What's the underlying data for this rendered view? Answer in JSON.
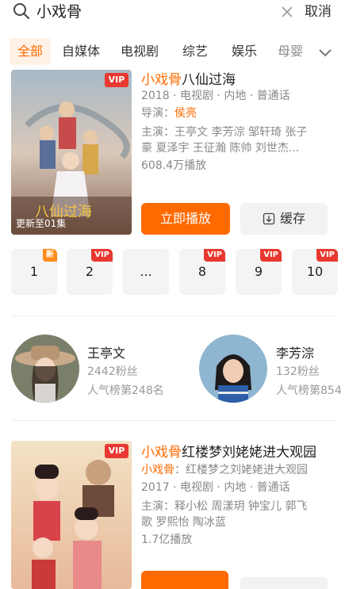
{
  "search": {
    "query": "小戏骨",
    "cancel_label": "取消"
  },
  "tabs": [
    {
      "label": "全部",
      "active": true
    },
    {
      "label": "自媒体"
    },
    {
      "label": "电视剧"
    },
    {
      "label": "综艺"
    },
    {
      "label": "娱乐"
    },
    {
      "label": "母婴"
    }
  ],
  "card1": {
    "title_highlight": "小戏骨",
    "title_rest": "八仙过海",
    "meta_line1": "2018 · 电视剧 · 内地 · 普通话",
    "director_prefix": "导演：",
    "director": "侯亮",
    "cast_line1": "主演：王亭文 李芳淙 邹轩琦 张子",
    "cast_line2": "豪 夏泽宇 王征瀚 陈帅 刘世杰...",
    "plays": "608.4万播放",
    "poster_badge": "VIP",
    "poster_caption": "更新至01集",
    "play_label": "立即播放",
    "cache_label": "缓存"
  },
  "episodes": [
    {
      "label": "1",
      "tag": "新",
      "tag_type": "new"
    },
    {
      "label": "2",
      "tag": "VIP",
      "tag_type": "vip"
    },
    {
      "label": "..."
    },
    {
      "label": "8",
      "tag": "VIP",
      "tag_type": "vip"
    },
    {
      "label": "9",
      "tag": "VIP",
      "tag_type": "vip"
    },
    {
      "label": "10",
      "tag": "VIP",
      "tag_type": "vip"
    }
  ],
  "people": [
    {
      "name": "王亭文",
      "fans": "2442粉丝",
      "rank": "人气榜第248名"
    },
    {
      "name": "李芳淙",
      "fans": "132粉丝",
      "rank": "人气榜第854"
    }
  ],
  "card2": {
    "title_highlight": "小戏骨",
    "title_rest": "红楼梦刘姥姥进大观园",
    "subtitle_highlight": "小戏骨",
    "subtitle_rest": "：红楼梦之刘姥姥进大观园",
    "meta_line1": "2017 · 电视剧 · 内地 · 普通话",
    "cast_line1": "主演：释小松 周漾玥 钟宝儿 郭飞",
    "cast_line2": "歌 罗熙怡 陶冰蓝",
    "plays": "1.7亿播放",
    "poster_badge": "VIP"
  },
  "colors": {
    "accent": "#ff6a00",
    "vip": "#e8382f"
  }
}
